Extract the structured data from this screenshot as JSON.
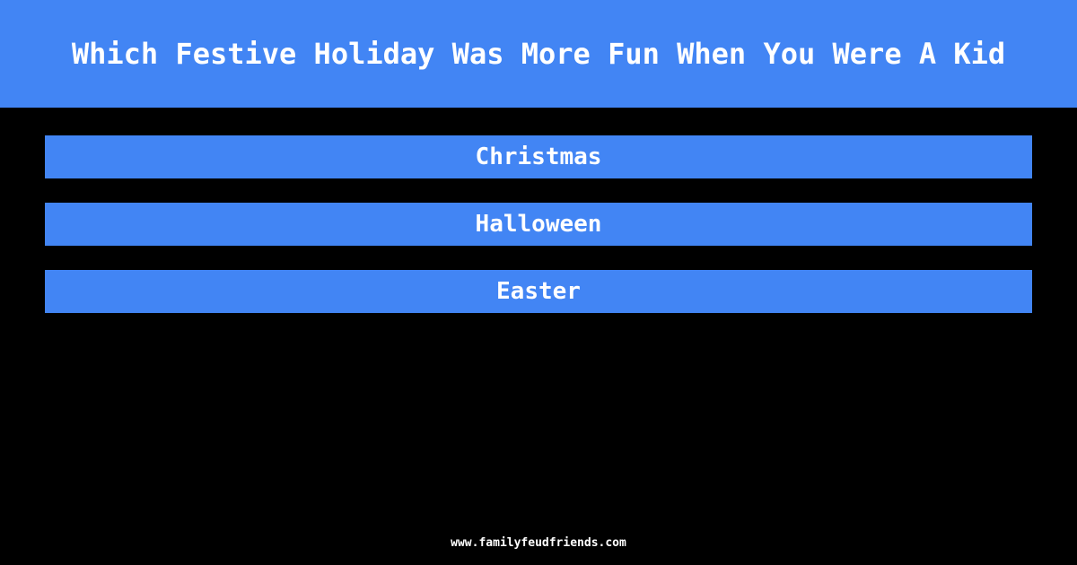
{
  "theme": {
    "background_color": "#000000",
    "accent_color": "#4285F4",
    "text_color": "#FFFFFF"
  },
  "header": {
    "title": "Which Festive Holiday Was More Fun When You Were A Kid"
  },
  "answers": {
    "items": [
      {
        "label": "Christmas"
      },
      {
        "label": "Halloween"
      },
      {
        "label": "Easter"
      }
    ]
  },
  "footer": {
    "url": "www.familyfeudfriends.com"
  }
}
